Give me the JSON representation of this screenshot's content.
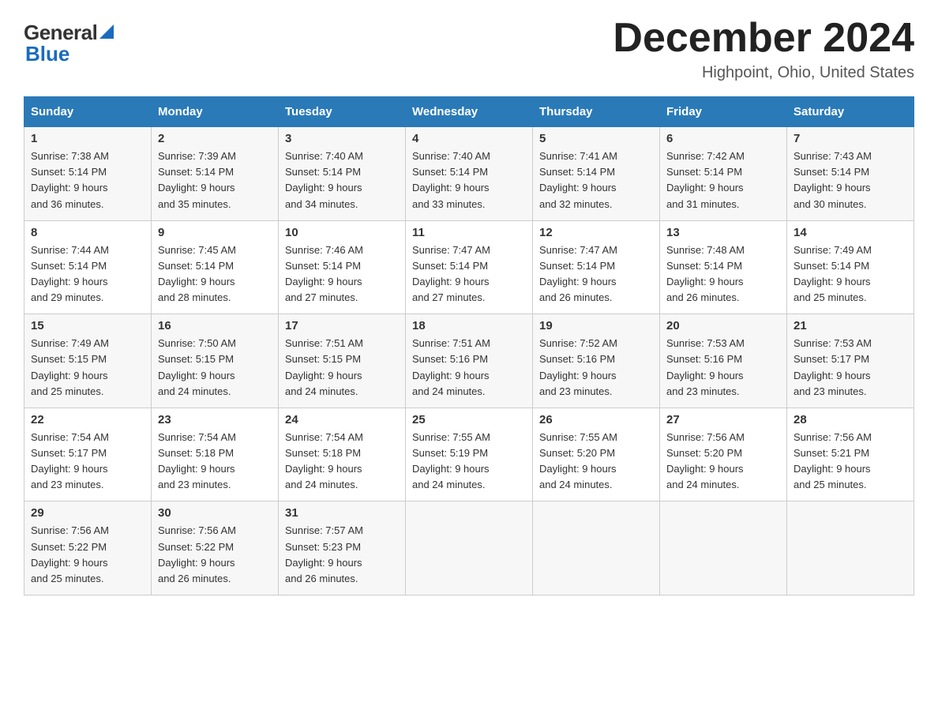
{
  "header": {
    "logo_line1": "General",
    "logo_line2": "Blue",
    "month_title": "December 2024",
    "subtitle": "Highpoint, Ohio, United States"
  },
  "days_of_week": [
    "Sunday",
    "Monday",
    "Tuesday",
    "Wednesday",
    "Thursday",
    "Friday",
    "Saturday"
  ],
  "weeks": [
    [
      {
        "day": "1",
        "sunrise": "7:38 AM",
        "sunset": "5:14 PM",
        "daylight": "9 hours and 36 minutes."
      },
      {
        "day": "2",
        "sunrise": "7:39 AM",
        "sunset": "5:14 PM",
        "daylight": "9 hours and 35 minutes."
      },
      {
        "day": "3",
        "sunrise": "7:40 AM",
        "sunset": "5:14 PM",
        "daylight": "9 hours and 34 minutes."
      },
      {
        "day": "4",
        "sunrise": "7:40 AM",
        "sunset": "5:14 PM",
        "daylight": "9 hours and 33 minutes."
      },
      {
        "day": "5",
        "sunrise": "7:41 AM",
        "sunset": "5:14 PM",
        "daylight": "9 hours and 32 minutes."
      },
      {
        "day": "6",
        "sunrise": "7:42 AM",
        "sunset": "5:14 PM",
        "daylight": "9 hours and 31 minutes."
      },
      {
        "day": "7",
        "sunrise": "7:43 AM",
        "sunset": "5:14 PM",
        "daylight": "9 hours and 30 minutes."
      }
    ],
    [
      {
        "day": "8",
        "sunrise": "7:44 AM",
        "sunset": "5:14 PM",
        "daylight": "9 hours and 29 minutes."
      },
      {
        "day": "9",
        "sunrise": "7:45 AM",
        "sunset": "5:14 PM",
        "daylight": "9 hours and 28 minutes."
      },
      {
        "day": "10",
        "sunrise": "7:46 AM",
        "sunset": "5:14 PM",
        "daylight": "9 hours and 27 minutes."
      },
      {
        "day": "11",
        "sunrise": "7:47 AM",
        "sunset": "5:14 PM",
        "daylight": "9 hours and 27 minutes."
      },
      {
        "day": "12",
        "sunrise": "7:47 AM",
        "sunset": "5:14 PM",
        "daylight": "9 hours and 26 minutes."
      },
      {
        "day": "13",
        "sunrise": "7:48 AM",
        "sunset": "5:14 PM",
        "daylight": "9 hours and 26 minutes."
      },
      {
        "day": "14",
        "sunrise": "7:49 AM",
        "sunset": "5:14 PM",
        "daylight": "9 hours and 25 minutes."
      }
    ],
    [
      {
        "day": "15",
        "sunrise": "7:49 AM",
        "sunset": "5:15 PM",
        "daylight": "9 hours and 25 minutes."
      },
      {
        "day": "16",
        "sunrise": "7:50 AM",
        "sunset": "5:15 PM",
        "daylight": "9 hours and 24 minutes."
      },
      {
        "day": "17",
        "sunrise": "7:51 AM",
        "sunset": "5:15 PM",
        "daylight": "9 hours and 24 minutes."
      },
      {
        "day": "18",
        "sunrise": "7:51 AM",
        "sunset": "5:16 PM",
        "daylight": "9 hours and 24 minutes."
      },
      {
        "day": "19",
        "sunrise": "7:52 AM",
        "sunset": "5:16 PM",
        "daylight": "9 hours and 23 minutes."
      },
      {
        "day": "20",
        "sunrise": "7:53 AM",
        "sunset": "5:16 PM",
        "daylight": "9 hours and 23 minutes."
      },
      {
        "day": "21",
        "sunrise": "7:53 AM",
        "sunset": "5:17 PM",
        "daylight": "9 hours and 23 minutes."
      }
    ],
    [
      {
        "day": "22",
        "sunrise": "7:54 AM",
        "sunset": "5:17 PM",
        "daylight": "9 hours and 23 minutes."
      },
      {
        "day": "23",
        "sunrise": "7:54 AM",
        "sunset": "5:18 PM",
        "daylight": "9 hours and 23 minutes."
      },
      {
        "day": "24",
        "sunrise": "7:54 AM",
        "sunset": "5:18 PM",
        "daylight": "9 hours and 24 minutes."
      },
      {
        "day": "25",
        "sunrise": "7:55 AM",
        "sunset": "5:19 PM",
        "daylight": "9 hours and 24 minutes."
      },
      {
        "day": "26",
        "sunrise": "7:55 AM",
        "sunset": "5:20 PM",
        "daylight": "9 hours and 24 minutes."
      },
      {
        "day": "27",
        "sunrise": "7:56 AM",
        "sunset": "5:20 PM",
        "daylight": "9 hours and 24 minutes."
      },
      {
        "day": "28",
        "sunrise": "7:56 AM",
        "sunset": "5:21 PM",
        "daylight": "9 hours and 25 minutes."
      }
    ],
    [
      {
        "day": "29",
        "sunrise": "7:56 AM",
        "sunset": "5:22 PM",
        "daylight": "9 hours and 25 minutes."
      },
      {
        "day": "30",
        "sunrise": "7:56 AM",
        "sunset": "5:22 PM",
        "daylight": "9 hours and 26 minutes."
      },
      {
        "day": "31",
        "sunrise": "7:57 AM",
        "sunset": "5:23 PM",
        "daylight": "9 hours and 26 minutes."
      },
      null,
      null,
      null,
      null
    ]
  ],
  "labels": {
    "sunrise": "Sunrise:",
    "sunset": "Sunset:",
    "daylight": "Daylight:"
  }
}
